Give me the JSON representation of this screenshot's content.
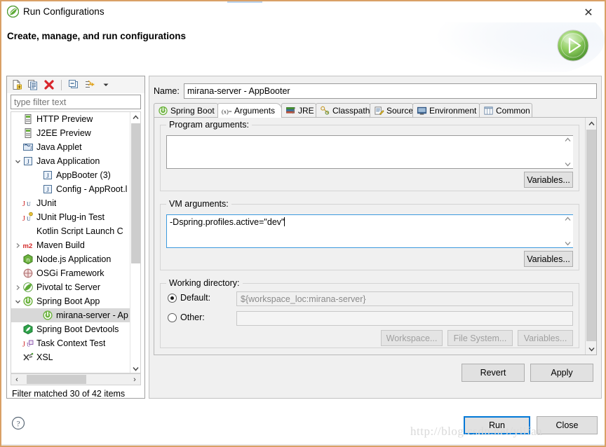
{
  "window": {
    "title": "Run Configurations",
    "title_icon": "spring-leaf-icon",
    "close_label": "✕"
  },
  "header": {
    "heading": "Create, manage, and run configurations",
    "run_icon": "run-play-icon"
  },
  "tree_toolbar": {
    "buttons": [
      {
        "name": "new-configuration-icon",
        "label": ""
      },
      {
        "name": "duplicate-configuration-icon",
        "label": ""
      },
      {
        "name": "delete-configuration-icon",
        "label": ""
      },
      {
        "name": "collapse-all-icon",
        "label": ""
      },
      {
        "name": "filter-icon",
        "label": ""
      },
      {
        "name": "view-menu-chevron-icon",
        "label": ""
      }
    ]
  },
  "filter": {
    "placeholder": "type filter text",
    "value": "",
    "status": "Filter matched 30 of 42 items"
  },
  "tree": {
    "items": [
      {
        "label": "HTTP Preview",
        "icon": "server-icon",
        "indent": 1,
        "twisty": "",
        "selected": false
      },
      {
        "label": "J2EE Preview",
        "icon": "server-icon",
        "indent": 1,
        "twisty": "",
        "selected": false
      },
      {
        "label": "Java Applet",
        "icon": "java-applet-icon",
        "indent": 1,
        "twisty": "",
        "selected": false
      },
      {
        "label": "Java Application",
        "icon": "java-application-icon",
        "indent": 1,
        "twisty": "expanded",
        "selected": false
      },
      {
        "label": "AppBooter (3)",
        "icon": "java-application-icon",
        "indent": 2,
        "twisty": "",
        "selected": false
      },
      {
        "label": "Config - AppRoot.l",
        "icon": "java-application-icon",
        "indent": 2,
        "twisty": "",
        "selected": false
      },
      {
        "label": "JUnit",
        "icon": "junit-icon",
        "indent": 1,
        "twisty": "",
        "selected": false
      },
      {
        "label": "JUnit Plug-in Test",
        "icon": "junit-plugin-icon",
        "indent": 1,
        "twisty": "",
        "selected": false
      },
      {
        "label": "Kotlin Script Launch C",
        "icon": "none",
        "indent": 1,
        "twisty": "",
        "selected": false
      },
      {
        "label": "Maven Build",
        "icon": "maven-icon",
        "indent": 1,
        "twisty": "collapsed",
        "selected": false
      },
      {
        "label": "Node.js Application",
        "icon": "nodejs-icon",
        "indent": 1,
        "twisty": "",
        "selected": false
      },
      {
        "label": "OSGi Framework",
        "icon": "osgi-icon",
        "indent": 1,
        "twisty": "",
        "selected": false
      },
      {
        "label": "Pivotal tc Server",
        "icon": "pivotal-icon",
        "indent": 1,
        "twisty": "collapsed",
        "selected": false
      },
      {
        "label": "Spring Boot App",
        "icon": "spring-boot-icon",
        "indent": 1,
        "twisty": "expanded",
        "selected": false
      },
      {
        "label": "mirana-server - Ap",
        "icon": "spring-boot-icon",
        "indent": 2,
        "twisty": "",
        "selected": true
      },
      {
        "label": "Spring Boot Devtools",
        "icon": "spring-devtools-icon",
        "indent": 1,
        "twisty": "",
        "selected": false
      },
      {
        "label": "Task Context Test",
        "icon": "task-context-icon",
        "indent": 1,
        "twisty": "",
        "selected": false
      },
      {
        "label": "XSL",
        "icon": "xsl-icon",
        "indent": 1,
        "twisty": "",
        "selected": false
      }
    ]
  },
  "config": {
    "name_label": "Name:",
    "name_value": "mirana-server - AppBooter"
  },
  "tabs": [
    {
      "label": "Spring Boot",
      "icon": "spring-boot-icon",
      "active": false
    },
    {
      "label": "Arguments",
      "icon": "arguments-icon",
      "active": true
    },
    {
      "label": "JRE",
      "icon": "jre-icon",
      "active": false
    },
    {
      "label": "Classpath",
      "icon": "classpath-icon",
      "active": false
    },
    {
      "label": "Source",
      "icon": "source-icon",
      "active": false
    },
    {
      "label": "Environment",
      "icon": "environment-icon",
      "active": false
    },
    {
      "label": "Common",
      "icon": "common-icon",
      "active": false
    }
  ],
  "arguments_tab": {
    "program_arguments": {
      "title": "Program arguments:",
      "value": "",
      "variables_button": "Variables..."
    },
    "vm_arguments": {
      "title": "VM arguments:",
      "value": "-Dspring.profiles.active=\"dev\"",
      "variables_button": "Variables..."
    },
    "working_directory": {
      "title": "Working directory:",
      "default_label": "Default:",
      "default_selected": true,
      "default_value": "${workspace_loc:mirana-server}",
      "other_label": "Other:",
      "other_selected": false,
      "other_value": "",
      "workspace_button": "Workspace...",
      "file_system_button": "File System...",
      "variables_button": "Variables..."
    }
  },
  "actions": {
    "revert": "Revert",
    "apply": "Apply",
    "run": "Run",
    "close": "Close"
  },
  "watermark": "http://blog.csdn.net/yiifaa",
  "colors": {
    "accent_blue": "#0078d7",
    "spring_green": "#6db33f",
    "panel_bg": "#f0f0f0",
    "window_border": "#d9a066",
    "selection": "#d8d8d8"
  }
}
